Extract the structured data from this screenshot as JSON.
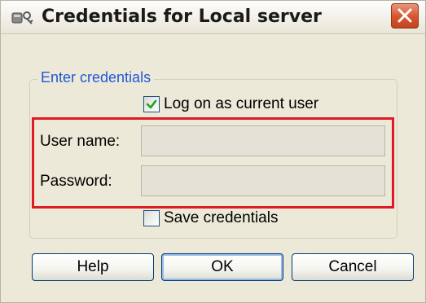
{
  "window": {
    "title": "Credentials for Local server"
  },
  "group": {
    "legend": "Enter credentials",
    "log_on_current_user": {
      "label": "Log on as current user",
      "checked": true
    },
    "user_name": {
      "label": "User name:",
      "value": ""
    },
    "password": {
      "label": "Password:",
      "value": ""
    },
    "save_credentials": {
      "label": "Save credentials",
      "checked": false
    }
  },
  "buttons": {
    "help": "Help",
    "ok": "OK",
    "cancel": "Cancel"
  },
  "colors": {
    "dialog_bg": "#ece9d8",
    "highlight": "#e01a22",
    "legend_text": "#2157d6",
    "close_button": "#d8532d"
  }
}
